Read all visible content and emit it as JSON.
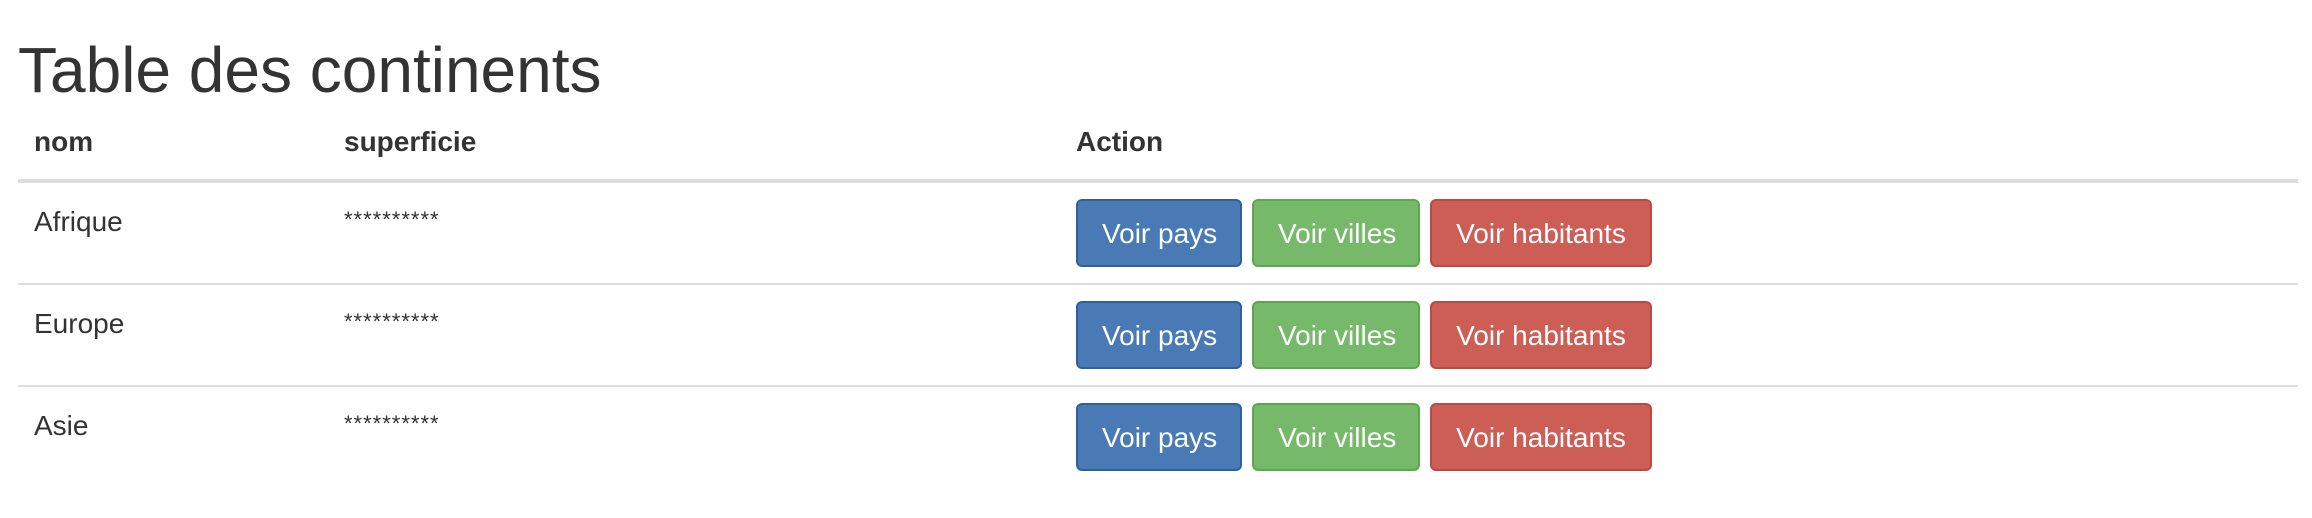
{
  "page": {
    "title": "Table des continents"
  },
  "table": {
    "headers": {
      "name": "nom",
      "area": "superficie",
      "action": "Action"
    },
    "rows": [
      {
        "name": "Afrique",
        "area": "**********"
      },
      {
        "name": "Europe",
        "area": "**********"
      },
      {
        "name": "Asie",
        "area": "**********"
      }
    ]
  },
  "actions": {
    "view_countries": "Voir pays",
    "view_cities": "Voir villes",
    "view_inhabitants": "Voir habitants"
  },
  "colors": {
    "primary": "#4a7ab5",
    "success": "#77b96a",
    "danger": "#cc5e56",
    "text": "#333333",
    "border": "#dddddd"
  }
}
